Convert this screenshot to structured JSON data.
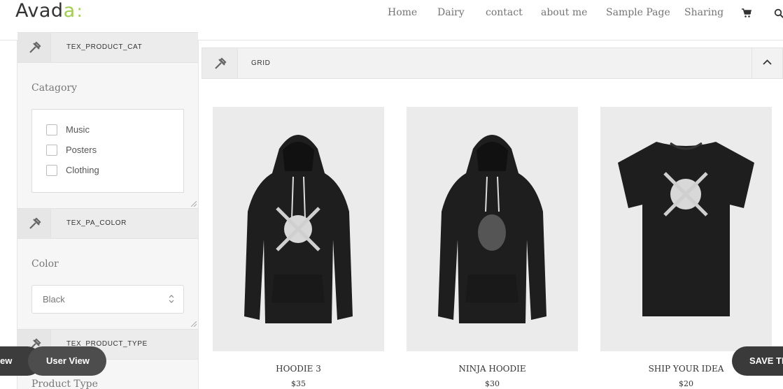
{
  "brand": {
    "name_main": "Avad",
    "name_accent": "a",
    "name_dots": ":",
    "accent_color": "#a0ce4e"
  },
  "nav": {
    "items": [
      "Home",
      "Dairy",
      "contact",
      "about me",
      "Sample Page",
      "Sharing"
    ],
    "cart_icon": "shopping-cart-icon",
    "search_icon": "search-icon"
  },
  "sidebar": {
    "panels": [
      {
        "title": "TEX_PRODUCT_CAT",
        "icon": "tools-icon"
      },
      {
        "title": "TEX_PA_COLOR",
        "icon": "tools-icon"
      },
      {
        "title": "TEX_PRODUCT_TYPE",
        "icon": "tools-icon"
      }
    ],
    "category": {
      "label": "Catagory",
      "options": [
        {
          "label": "Music",
          "checked": false
        },
        {
          "label": "Posters",
          "checked": false
        },
        {
          "label": "Clothing",
          "checked": false
        }
      ]
    },
    "color": {
      "label": "Color",
      "value": "Black"
    },
    "product_type": {
      "label": "Product Type"
    }
  },
  "grid": {
    "title": "GRID",
    "collapse_icon": "chevron-up-icon",
    "products": [
      {
        "name": "HOODIE 3",
        "price": "$35"
      },
      {
        "name": "NINJA HOODIE",
        "price": "$30"
      },
      {
        "name": "SHIP YOUR IDEA",
        "price": "$20"
      }
    ]
  },
  "buttons": {
    "back_view": "ew",
    "user_view": "User View",
    "save": "SAVE TE"
  }
}
